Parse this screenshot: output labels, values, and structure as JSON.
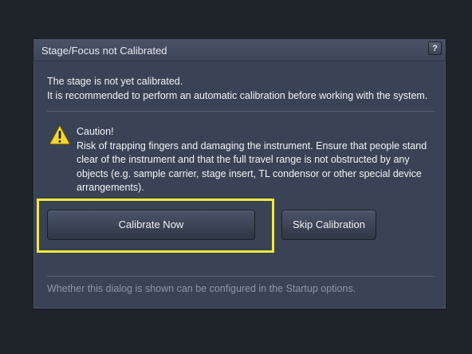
{
  "dialog": {
    "title": "Stage/Focus not Calibrated",
    "help_label": "?",
    "message_line1": "The stage is not yet calibrated.",
    "message_line2": "It is recommended to perform an automatic calibration before working with the system.",
    "caution_title": "Caution!",
    "caution_body": "Risk of trapping fingers and damaging the instrument. Ensure that people stand clear of the instrument and that the full travel range is not obstructed by any objects (e.g. sample carrier, stage insert, TL condensor or other special device arrangements).",
    "calibrate_label": "Calibrate Now",
    "skip_label": "Skip Calibration",
    "footer_note": "Whether this dialog is shown can be configured in the Startup options."
  },
  "colors": {
    "highlight": "#f0e83a",
    "dialog_bg": "#3a4355",
    "caution_icon": "#f2d633"
  },
  "icons": {
    "caution": "warning-triangle-icon",
    "help": "question-mark-icon"
  }
}
